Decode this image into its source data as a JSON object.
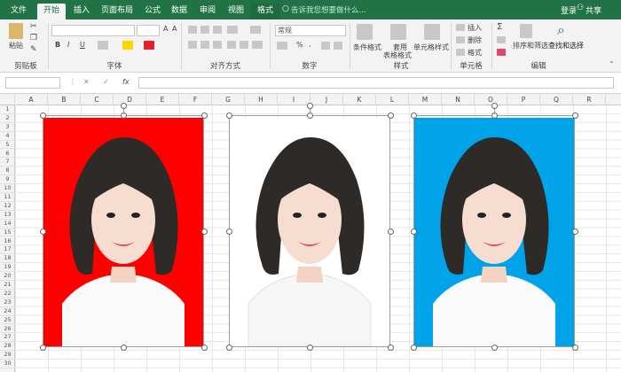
{
  "tabs": [
    "文件",
    "开始",
    "插入",
    "页面布局",
    "公式",
    "数据",
    "审阅",
    "视图",
    "格式"
  ],
  "active_tab": "开始",
  "tell_me": "告诉我您想要做什么...",
  "login": "登录",
  "share": "共享",
  "ribbon": {
    "paste": "粘贴",
    "clipboard": "剪贴板",
    "font": "字体",
    "alignment": "对齐方式",
    "number_format": "常规",
    "number": "数字",
    "conditional": "条件格式",
    "as_table_1": "套用",
    "as_table_2": "表格格式",
    "cell_style": "单元格样式",
    "styles": "样式",
    "insert": "插入",
    "delete": "删除",
    "format": "格式",
    "cells": "单元格",
    "sort": "排序和筛选",
    "find": "查找和选择",
    "editing": "编辑",
    "bold": "B",
    "italic": "I",
    "underline": "U",
    "percent": "%",
    "comma": ","
  },
  "formula_bar": {
    "name_box": "",
    "fx": "fx",
    "formula": ""
  },
  "columns": [
    "A",
    "B",
    "C",
    "D",
    "E",
    "F",
    "G",
    "H",
    "I",
    "J",
    "K",
    "L",
    "M",
    "N",
    "O",
    "P",
    "Q",
    "R"
  ],
  "rows": [
    "1",
    "2",
    "3",
    "4",
    "5",
    "6",
    "7",
    "8",
    "9",
    "10",
    "11",
    "12",
    "13",
    "14",
    "15",
    "16",
    "17",
    "18",
    "19",
    "20",
    "21",
    "22",
    "23",
    "24",
    "25",
    "26",
    "27",
    "28",
    "29",
    "30"
  ],
  "photos": [
    {
      "background": "red",
      "color": "#ff0000"
    },
    {
      "background": "white",
      "color": "#ffffff"
    },
    {
      "background": "blue",
      "color": "#00a2e8"
    }
  ],
  "colors": {
    "accent": "#217346"
  }
}
